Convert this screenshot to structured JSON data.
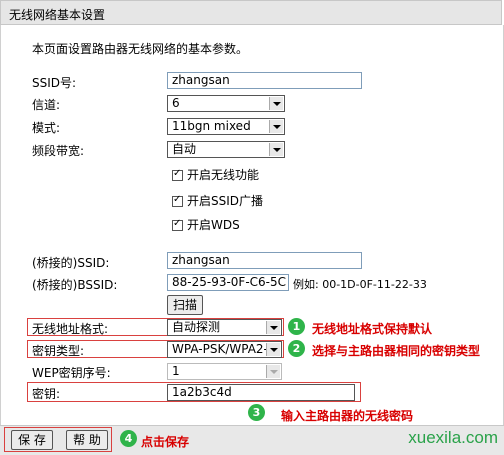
{
  "title": "无线网络基本设置",
  "description": "本页面设置路由器无线网络的基本参数。",
  "fields": {
    "ssid": {
      "label": "SSID号:",
      "value": "zhangsan"
    },
    "channel": {
      "label": "信道:",
      "value": "6"
    },
    "mode": {
      "label": "模式:",
      "value": "11bgn mixed"
    },
    "bandwidth": {
      "label": "频段带宽:",
      "value": "自动"
    },
    "checkboxes": [
      "开启无线功能",
      "开启SSID广播",
      "开启WDS"
    ],
    "bridged_ssid": {
      "label": "(桥接的)SSID:",
      "value": "zhangsan"
    },
    "bridged_bssid": {
      "label": "(桥接的)BSSID:",
      "value": "88-25-93-0F-C6-5C",
      "example": "例如: 00-1D-0F-11-22-33"
    },
    "scan_button": "扫描",
    "addr_format": {
      "label": "无线地址格式:",
      "value": "自动探测"
    },
    "key_type": {
      "label": "密钥类型:",
      "value": "WPA-PSK/WPA2-"
    },
    "wep_index": {
      "label": "WEP密钥序号:",
      "value": "1"
    },
    "key": {
      "label": "密钥:",
      "value": "1a2b3c4d"
    }
  },
  "annotations": {
    "n1": "1",
    "t1": "无线地址格式保持默认",
    "n2": "2",
    "t2": "选择与主路由器相同的密钥类型",
    "n3": "3",
    "t3": "输入主路由器的无线密码",
    "n4": "4",
    "t4": "点击保存"
  },
  "footer": {
    "save": "保 存",
    "help": "帮 助"
  },
  "watermark": "xuexila.com",
  "colors": {
    "annotation_red": "#d80000",
    "badge_green": "#2fb44a"
  }
}
